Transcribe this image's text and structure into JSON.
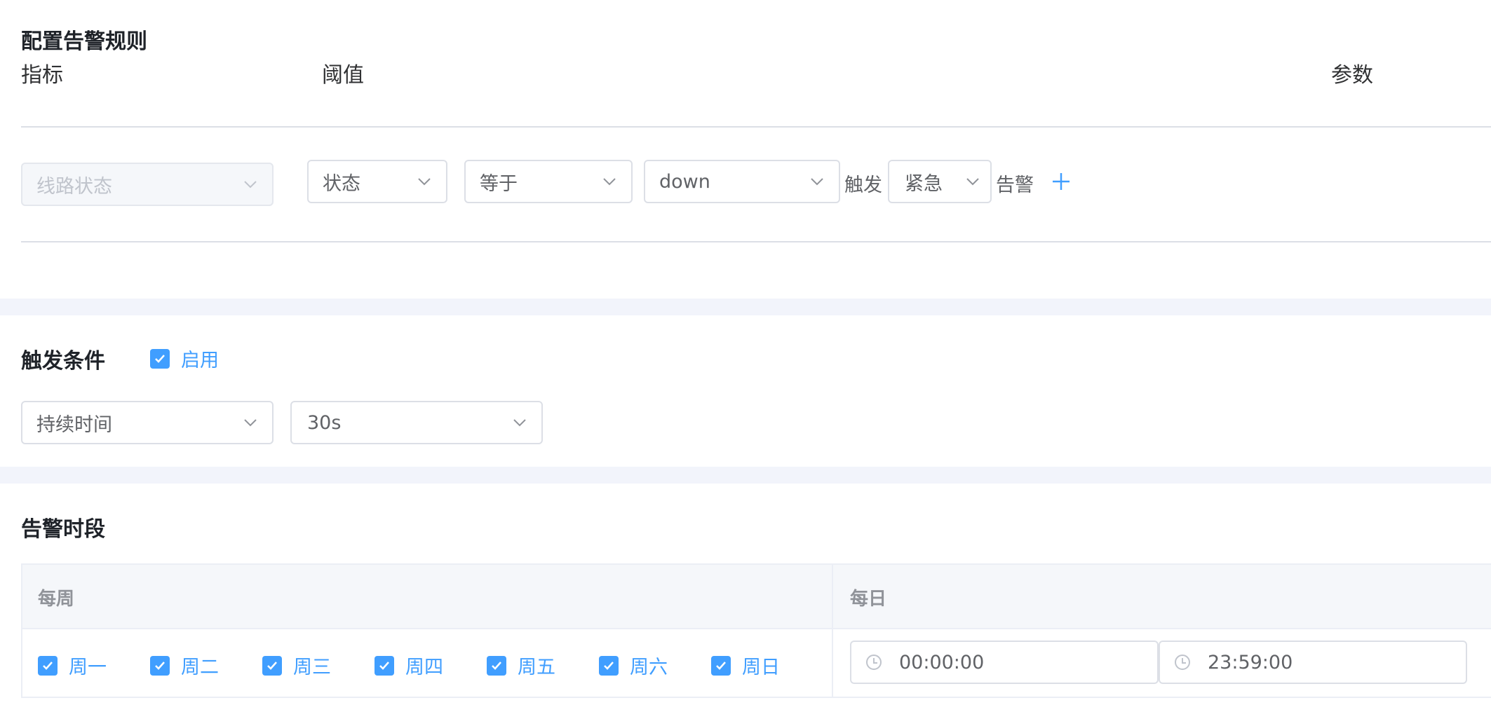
{
  "alert_rule": {
    "title": "配置告警规则",
    "columns": {
      "metric": "指标",
      "threshold": "阈值",
      "params": "参数"
    },
    "metric_select": {
      "value": "线路状态",
      "disabled": true
    },
    "field_select": {
      "value": "状态"
    },
    "operator_select": {
      "value": "等于"
    },
    "value_select": {
      "value": "down"
    },
    "trigger_text": "触发",
    "level_select": {
      "value": "紧急"
    },
    "alert_text": "告警",
    "add_icon": "plus-icon",
    "colors": {
      "accent": "#409eff"
    }
  },
  "trigger_condition": {
    "title": "触发条件",
    "enable": {
      "label": "启用",
      "checked": true
    },
    "type_select": {
      "value": "持续时间"
    },
    "duration_select": {
      "value": "30s"
    }
  },
  "alert_period": {
    "title": "告警时段",
    "headers": {
      "weekly": "每周",
      "daily": "每日"
    },
    "days": [
      {
        "label": "周一",
        "checked": true
      },
      {
        "label": "周二",
        "checked": true
      },
      {
        "label": "周三",
        "checked": true
      },
      {
        "label": "周四",
        "checked": true
      },
      {
        "label": "周五",
        "checked": true
      },
      {
        "label": "周六",
        "checked": true
      },
      {
        "label": "周日",
        "checked": true
      }
    ],
    "start_time": "00:00:00",
    "end_time": "23:59:00"
  }
}
